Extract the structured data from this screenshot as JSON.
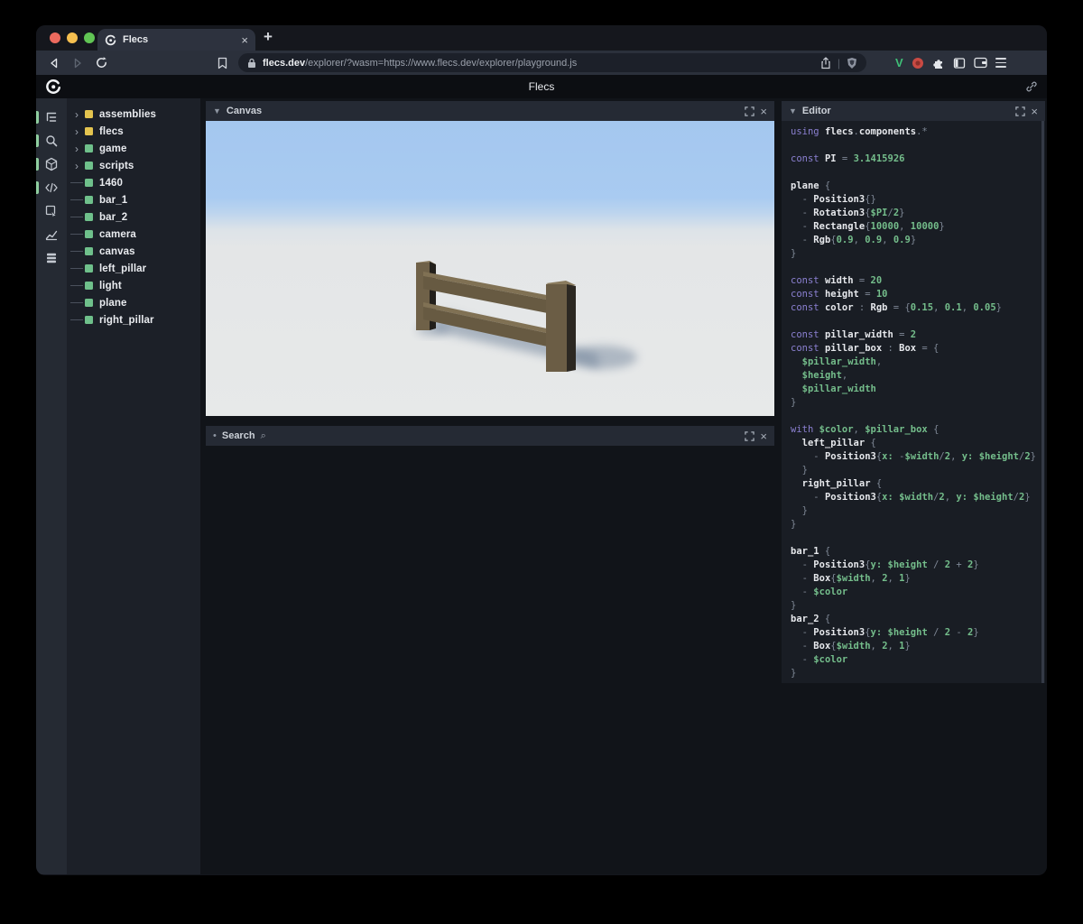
{
  "browser": {
    "tab": {
      "title": "Flecs",
      "close_label": "×"
    },
    "new_tab_label": "+",
    "url_domain": "flecs.dev",
    "url_path": "/explorer/?wasm=https://www.flecs.dev/explorer/playground.js",
    "url_divider": "|"
  },
  "app_header": {
    "title": "Flecs"
  },
  "sidebar": {
    "icons": [
      {
        "name": "entity-tree-icon",
        "active": true
      },
      {
        "name": "search-icon",
        "active": true
      },
      {
        "name": "entities-cube-icon",
        "active": true
      },
      {
        "name": "script-code-icon",
        "active": true
      },
      {
        "name": "query-inspect-icon",
        "active": false
      },
      {
        "name": "stats-chart-icon",
        "active": false
      },
      {
        "name": "tables-icon",
        "active": false
      }
    ]
  },
  "tree": {
    "items": [
      {
        "label": "assemblies",
        "expandable": true,
        "badge_color": "#e4c44f"
      },
      {
        "label": "flecs",
        "expandable": true,
        "badge_color": "#e4c44f"
      },
      {
        "label": "game",
        "expandable": true,
        "badge_color": "#6fc08b"
      },
      {
        "label": "scripts",
        "expandable": true,
        "badge_color": "#6fc08b"
      },
      {
        "label": "1460",
        "expandable": false,
        "badge_color": "#6fc08b"
      },
      {
        "label": "bar_1",
        "expandable": false,
        "badge_color": "#6fc08b"
      },
      {
        "label": "bar_2",
        "expandable": false,
        "badge_color": "#6fc08b"
      },
      {
        "label": "camera",
        "expandable": false,
        "badge_color": "#6fc08b"
      },
      {
        "label": "canvas",
        "expandable": false,
        "badge_color": "#6fc08b"
      },
      {
        "label": "left_pillar",
        "expandable": false,
        "badge_color": "#6fc08b"
      },
      {
        "label": "light",
        "expandable": false,
        "badge_color": "#6fc08b"
      },
      {
        "label": "plane",
        "expandable": false,
        "badge_color": "#6fc08b"
      },
      {
        "label": "right_pillar",
        "expandable": false,
        "badge_color": "#6fc08b"
      }
    ]
  },
  "panels": {
    "canvas": {
      "title": "Canvas"
    },
    "search": {
      "title": "Search"
    },
    "editor": {
      "title": "Editor"
    }
  },
  "colors": {
    "keyword": "#8b80d1",
    "identifier": "#e6e8ec",
    "number": "#74bd8b",
    "punct": "#7e8795",
    "active_indicator": "#8fce9f",
    "sky": "#a6c9f0",
    "ground": "#e5e7e8",
    "wood": "#6b5d45"
  },
  "editor": {
    "lines": [
      [
        [
          "k",
          "using "
        ],
        [
          "i",
          "flecs"
        ],
        [
          "p",
          "."
        ],
        [
          "i",
          "components"
        ],
        [
          "p",
          ".*"
        ]
      ],
      [],
      [
        [
          "k",
          "const "
        ],
        [
          "i",
          "PI"
        ],
        [
          "p",
          " = "
        ],
        [
          "n",
          "3.1415926"
        ]
      ],
      [],
      [
        [
          "i",
          "plane"
        ],
        [
          "p",
          " {"
        ]
      ],
      [
        [
          "p",
          "  - "
        ],
        [
          "i",
          "Position3"
        ],
        [
          "p",
          "{}"
        ]
      ],
      [
        [
          "p",
          "  - "
        ],
        [
          "i",
          "Rotation3"
        ],
        [
          "p",
          "{"
        ],
        [
          "n",
          "$PI"
        ],
        [
          "p",
          "/"
        ],
        [
          "n",
          "2"
        ],
        [
          "p",
          "}"
        ]
      ],
      [
        [
          "p",
          "  - "
        ],
        [
          "i",
          "Rectangle"
        ],
        [
          "p",
          "{"
        ],
        [
          "n",
          "10000"
        ],
        [
          "p",
          ", "
        ],
        [
          "n",
          "10000"
        ],
        [
          "p",
          "}"
        ]
      ],
      [
        [
          "p",
          "  - "
        ],
        [
          "i",
          "Rgb"
        ],
        [
          "p",
          "{"
        ],
        [
          "n",
          "0.9"
        ],
        [
          "p",
          ", "
        ],
        [
          "n",
          "0.9"
        ],
        [
          "p",
          ", "
        ],
        [
          "n",
          "0.9"
        ],
        [
          "p",
          "}"
        ]
      ],
      [
        [
          "p",
          "}"
        ]
      ],
      [],
      [
        [
          "k",
          "const "
        ],
        [
          "i",
          "width"
        ],
        [
          "p",
          " = "
        ],
        [
          "n",
          "20"
        ]
      ],
      [
        [
          "k",
          "const "
        ],
        [
          "i",
          "height"
        ],
        [
          "p",
          " = "
        ],
        [
          "n",
          "10"
        ]
      ],
      [
        [
          "k",
          "const "
        ],
        [
          "i",
          "color"
        ],
        [
          "p",
          " : "
        ],
        [
          "i",
          "Rgb"
        ],
        [
          "p",
          " = {"
        ],
        [
          "n",
          "0.15"
        ],
        [
          "p",
          ", "
        ],
        [
          "n",
          "0.1"
        ],
        [
          "p",
          ", "
        ],
        [
          "n",
          "0.05"
        ],
        [
          "p",
          "}"
        ]
      ],
      [],
      [
        [
          "k",
          "const "
        ],
        [
          "i",
          "pillar_width"
        ],
        [
          "p",
          " = "
        ],
        [
          "n",
          "2"
        ]
      ],
      [
        [
          "k",
          "const "
        ],
        [
          "i",
          "pillar_box"
        ],
        [
          "p",
          " : "
        ],
        [
          "i",
          "Box"
        ],
        [
          "p",
          " = {"
        ]
      ],
      [
        [
          "p",
          "  "
        ],
        [
          "n",
          "$pillar_width"
        ],
        [
          "p",
          ","
        ]
      ],
      [
        [
          "p",
          "  "
        ],
        [
          "n",
          "$height"
        ],
        [
          "p",
          ","
        ]
      ],
      [
        [
          "p",
          "  "
        ],
        [
          "n",
          "$pillar_width"
        ]
      ],
      [
        [
          "p",
          "}"
        ]
      ],
      [],
      [
        [
          "k",
          "with "
        ],
        [
          "n",
          "$color"
        ],
        [
          "p",
          ", "
        ],
        [
          "n",
          "$pillar_box"
        ],
        [
          "p",
          " {"
        ]
      ],
      [
        [
          "p",
          "  "
        ],
        [
          "i",
          "left_pillar"
        ],
        [
          "p",
          " {"
        ]
      ],
      [
        [
          "p",
          "    - "
        ],
        [
          "i",
          "Position3"
        ],
        [
          "p",
          "{"
        ],
        [
          "n",
          "x:"
        ],
        [
          "p",
          " -"
        ],
        [
          "n",
          "$width"
        ],
        [
          "p",
          "/"
        ],
        [
          "n",
          "2"
        ],
        [
          "p",
          ", "
        ],
        [
          "n",
          "y:"
        ],
        [
          "p",
          " "
        ],
        [
          "n",
          "$height"
        ],
        [
          "p",
          "/"
        ],
        [
          "n",
          "2"
        ],
        [
          "p",
          "}"
        ]
      ],
      [
        [
          "p",
          "  }"
        ]
      ],
      [
        [
          "p",
          "  "
        ],
        [
          "i",
          "right_pillar"
        ],
        [
          "p",
          " {"
        ]
      ],
      [
        [
          "p",
          "    - "
        ],
        [
          "i",
          "Position3"
        ],
        [
          "p",
          "{"
        ],
        [
          "n",
          "x:"
        ],
        [
          "p",
          " "
        ],
        [
          "n",
          "$width"
        ],
        [
          "p",
          "/"
        ],
        [
          "n",
          "2"
        ],
        [
          "p",
          ", "
        ],
        [
          "n",
          "y:"
        ],
        [
          "p",
          " "
        ],
        [
          "n",
          "$height"
        ],
        [
          "p",
          "/"
        ],
        [
          "n",
          "2"
        ],
        [
          "p",
          "}"
        ]
      ],
      [
        [
          "p",
          "  }"
        ]
      ],
      [
        [
          "p",
          "}"
        ]
      ],
      [],
      [
        [
          "i",
          "bar_1"
        ],
        [
          "p",
          " {"
        ]
      ],
      [
        [
          "p",
          "  - "
        ],
        [
          "i",
          "Position3"
        ],
        [
          "p",
          "{"
        ],
        [
          "n",
          "y:"
        ],
        [
          "p",
          " "
        ],
        [
          "n",
          "$height"
        ],
        [
          "p",
          " / "
        ],
        [
          "n",
          "2"
        ],
        [
          "p",
          " + "
        ],
        [
          "n",
          "2"
        ],
        [
          "p",
          "}"
        ]
      ],
      [
        [
          "p",
          "  - "
        ],
        [
          "i",
          "Box"
        ],
        [
          "p",
          "{"
        ],
        [
          "n",
          "$width"
        ],
        [
          "p",
          ", "
        ],
        [
          "n",
          "2"
        ],
        [
          "p",
          ", "
        ],
        [
          "n",
          "1"
        ],
        [
          "p",
          "}"
        ]
      ],
      [
        [
          "p",
          "  - "
        ],
        [
          "n",
          "$color"
        ]
      ],
      [
        [
          "p",
          "}"
        ]
      ],
      [
        [
          "i",
          "bar_2"
        ],
        [
          "p",
          " {"
        ]
      ],
      [
        [
          "p",
          "  - "
        ],
        [
          "i",
          "Position3"
        ],
        [
          "p",
          "{"
        ],
        [
          "n",
          "y:"
        ],
        [
          "p",
          " "
        ],
        [
          "n",
          "$height"
        ],
        [
          "p",
          " / "
        ],
        [
          "n",
          "2"
        ],
        [
          "p",
          " - "
        ],
        [
          "n",
          "2"
        ],
        [
          "p",
          "}"
        ]
      ],
      [
        [
          "p",
          "  - "
        ],
        [
          "i",
          "Box"
        ],
        [
          "p",
          "{"
        ],
        [
          "n",
          "$width"
        ],
        [
          "p",
          ", "
        ],
        [
          "n",
          "2"
        ],
        [
          "p",
          ", "
        ],
        [
          "n",
          "1"
        ],
        [
          "p",
          "}"
        ]
      ],
      [
        [
          "p",
          "  - "
        ],
        [
          "n",
          "$color"
        ]
      ],
      [
        [
          "p",
          "}"
        ]
      ]
    ]
  }
}
